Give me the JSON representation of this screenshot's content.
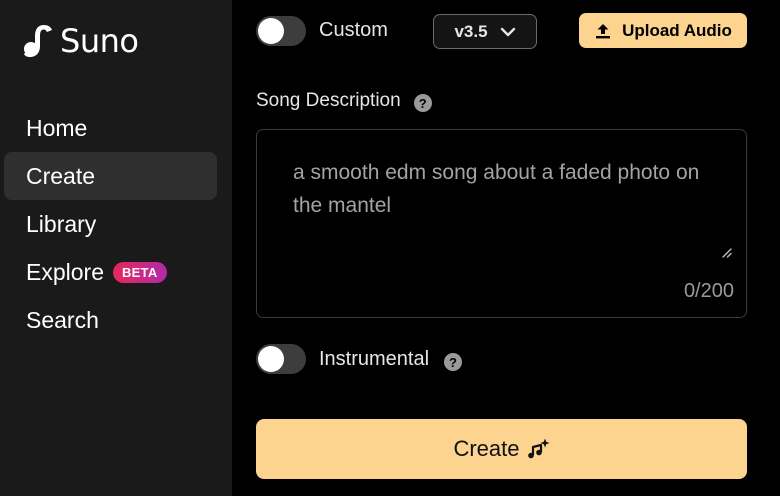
{
  "app": {
    "name": "Suno"
  },
  "sidebar": {
    "items": [
      {
        "label": "Home"
      },
      {
        "label": "Create",
        "active": true
      },
      {
        "label": "Library"
      },
      {
        "label": "Explore",
        "badge": "BETA"
      },
      {
        "label": "Search"
      }
    ]
  },
  "toolbar": {
    "custom_label": "Custom",
    "custom_enabled": false,
    "version": "v3.5",
    "upload_label": "Upload Audio"
  },
  "form": {
    "song_description_label": "Song Description",
    "song_description_value": "a smooth edm song about a faded photo on the mantel",
    "char_count": "0/200",
    "instrumental_label": "Instrumental",
    "instrumental_enabled": false,
    "help_glyph": "?",
    "create_label": "Create"
  },
  "colors": {
    "accent": "#fcd38f",
    "sidebar_bg": "#1a1a1a",
    "beta_gradient_start": "#e8285a",
    "beta_gradient_end": "#b02aa8"
  }
}
